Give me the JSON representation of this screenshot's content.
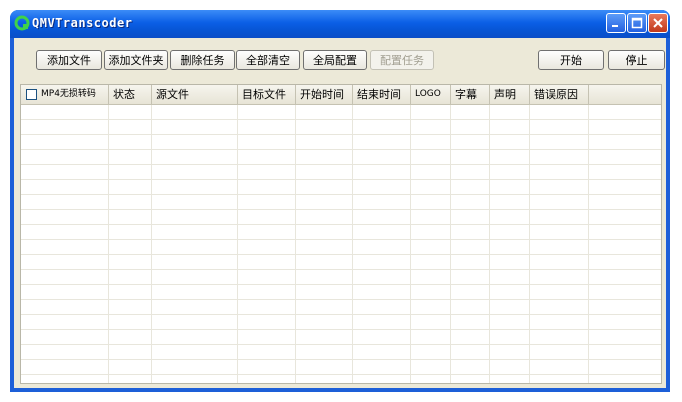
{
  "window": {
    "title": "QMVTranscoder"
  },
  "toolbar": {
    "add_file": "添加文件",
    "add_folder": "添加文件夹",
    "delete_task": "删除任务",
    "clear_all": "全部清空",
    "global_config": "全局配置",
    "config_task": "配置任务",
    "start": "开始",
    "stop": "停止"
  },
  "table": {
    "columns": [
      "MP4无损转码",
      "状态",
      "源文件",
      "目标文件",
      "开始时间",
      "结束时间",
      "LOGO",
      "字幕",
      "声明",
      "错误原因"
    ],
    "rows": []
  },
  "colors": {
    "titlebar": "#0b5fe6",
    "client_bg": "#ece9d8",
    "close_button": "#c0391c"
  }
}
